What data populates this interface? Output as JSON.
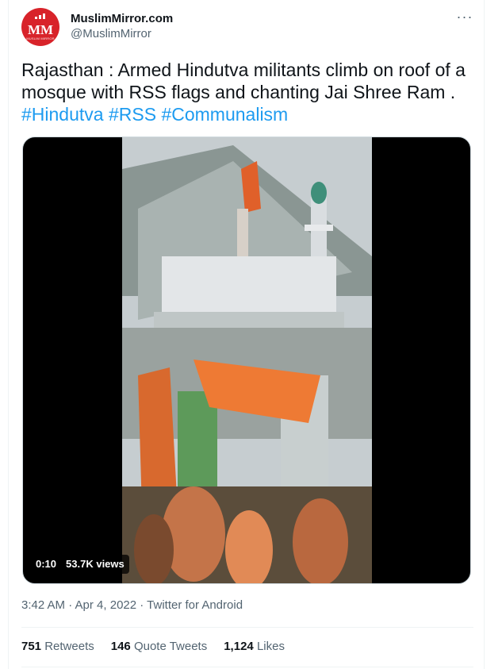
{
  "account": {
    "display_name": "MuslimMirror.com",
    "handle": "@MuslimMirror",
    "avatar_text": "MM",
    "avatar_subtext": "MUSLIM MIRROR"
  },
  "tweet": {
    "text_plain": "Rajasthan : Armed Hindutva militants climb on roof of a mosque with RSS flags and chanting Jai Shree Ram .",
    "hashtags": [
      "#Hindutva",
      "#RSS",
      "#Communalism"
    ]
  },
  "video": {
    "elapsed": "0:10",
    "views": "53.7K views"
  },
  "meta": {
    "timestamp": "3:42 AM · Apr 4, 2022 · Twitter for Android"
  },
  "stats": {
    "retweets_count": "751",
    "retweets_label": "Retweets",
    "quotes_count": "146",
    "quotes_label": "Quote Tweets",
    "likes_count": "1,124",
    "likes_label": "Likes"
  },
  "colors": {
    "link": "#1d9bf0",
    "secondary_text": "#536471",
    "avatar_red": "#d8232a"
  },
  "icons": [
    "more-icon"
  ]
}
